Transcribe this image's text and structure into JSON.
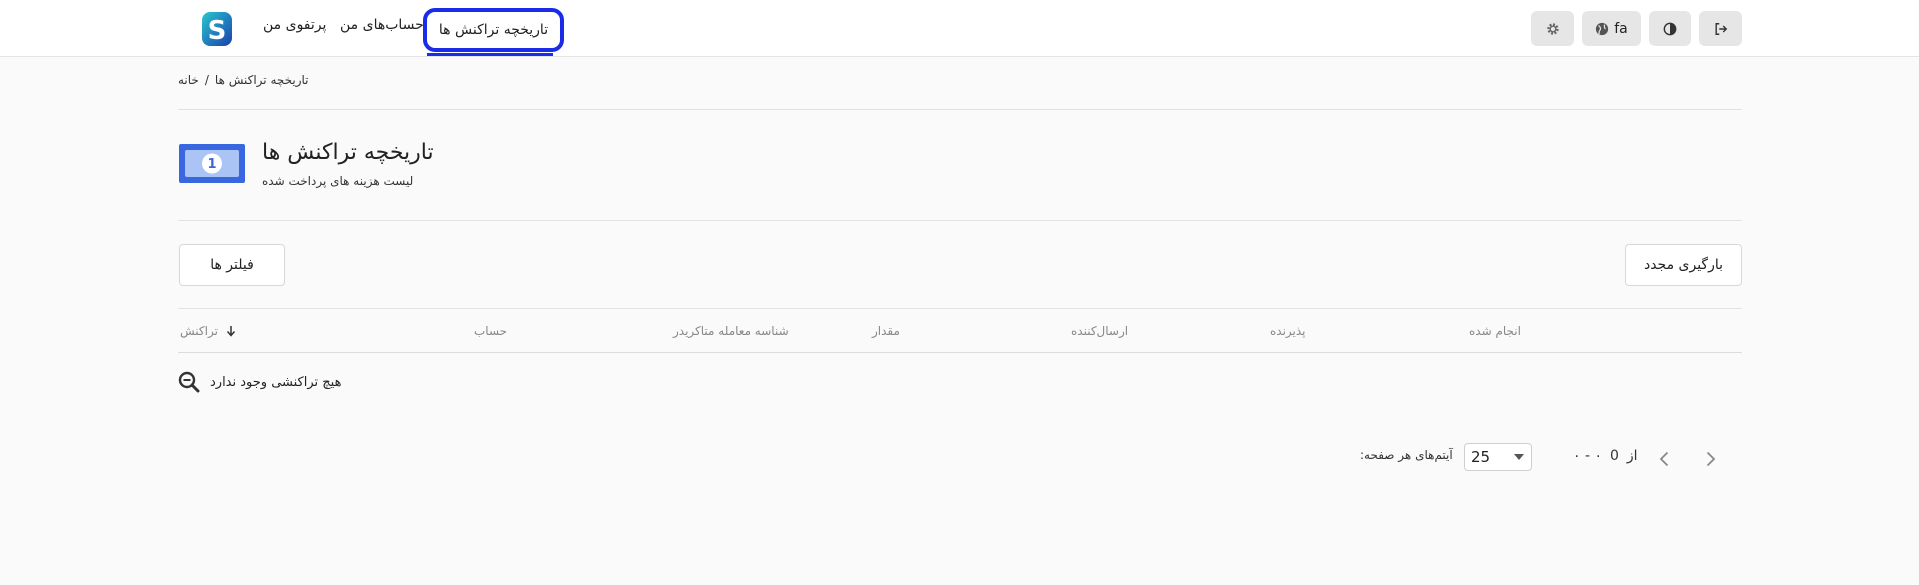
{
  "header": {
    "nav": {
      "portfolio": "پرتفوی من",
      "accounts": "حساب‌های من",
      "history": "تاریخچه تراکنش ها"
    },
    "language": "fa"
  },
  "breadcrumb": {
    "home": "خانه",
    "separator": "/",
    "current": "تاریخچه تراکنش ها"
  },
  "page": {
    "title": "تاریخچه تراکنش ها",
    "subtitle": "لیست هزینه های پرداخت شده",
    "icon_number": "1"
  },
  "actions": {
    "filters": "فیلتر ها",
    "reload": "بارگیری مجدد"
  },
  "table": {
    "headers": {
      "transaction": "تراکنش",
      "account": "حساب",
      "merchant_id": "شناسه معامله متاکریدر",
      "amount": "مقدار",
      "sender": "ارسال‌کننده",
      "receiver": "پذیرنده",
      "done": "انجام شده"
    },
    "empty_message": "هیچ تراکنشی وجود ندارد"
  },
  "pagination": {
    "items_per_page_label": ":آیتم‌های هر صفحه",
    "page_size": "25",
    "range": "۰ - ۰",
    "of_label": "از",
    "total": "0"
  },
  "colors": {
    "accent": "#1a2ce8",
    "logo_teal": "#1fb5c9",
    "logo_blue": "#1c3fae",
    "money_blue": "#3867e0"
  }
}
